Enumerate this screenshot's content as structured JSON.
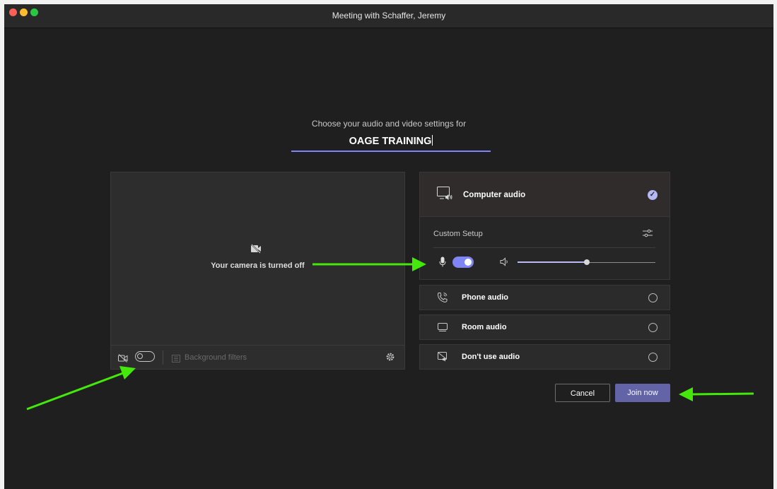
{
  "window": {
    "title": "Meeting with Schaffer, Jeremy"
  },
  "prejoin": {
    "heading": "Choose your audio and video settings for",
    "meeting_name": "OAGE TRAINING"
  },
  "video": {
    "camera_off_text": "Your camera is turned off",
    "camera_enabled": false,
    "background_filters_label": "Background filters"
  },
  "audio": {
    "computer_audio_label": "Computer audio",
    "computer_audio_selected": true,
    "custom_setup_label": "Custom Setup",
    "mic_enabled": true,
    "speaker_volume": 0.5,
    "phone_audio_label": "Phone audio",
    "room_audio_label": "Room audio",
    "no_audio_label": "Don't use audio"
  },
  "buttons": {
    "cancel_label": "Cancel",
    "join_label": "Join now"
  },
  "colors": {
    "accent": "#6264a7",
    "toggle_on": "#7f85f5",
    "annotation_arrow": "#44e80a"
  },
  "icons": {
    "camera_off": "camera-off-icon",
    "settings": "gear-icon",
    "mic": "microphone-icon",
    "speaker": "speaker-icon",
    "phone": "phone-icon",
    "room": "room-device-icon",
    "no_audio": "no-audio-icon"
  }
}
